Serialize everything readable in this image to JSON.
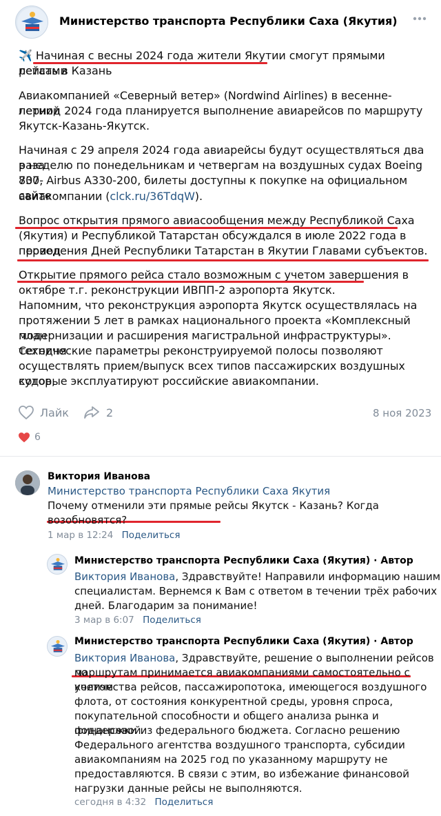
{
  "header": {
    "community_name": "Министерство транспорта Республики Саха (Якутия)",
    "more_icon": "more-horizontal-icon"
  },
  "post": {
    "emoji": "✈️",
    "title_line1": "Начиная с весны 2024 года жители Якутии смогут прямыми рейсами",
    "title_line2": "летать в Казань",
    "p2_line1": "Авиакомпанией «Северный ветер» (Nordwind Airlines) в весенне-летний",
    "p2_line2": "период 2024 года планируется выполнение авиарейсов по маршруту",
    "p2_line3": "Якутск-Казань-Якутск.",
    "p3_line1": "Начиная с 29 апреля 2024 года авиарейсы будут осуществляться два раза",
    "p3_line2": "в неделю по понедельникам и четвергам на воздушных судах Boeing 737-",
    "p3_line3": "800, Airbus A330-200, билеты доступны к покупке на официальном сайте",
    "p3_line4_pre": "авиакомпании (",
    "p3_link": "clck.ru/36TdqW",
    "p3_line4_post": ").",
    "p4_line1": "Вопрос открытия прямого авиасообщения между Республикой Саха",
    "p4_line2": "(Якутия) и Республикой Татарстан обсуждался в июле 2022 года в период",
    "p4_line3": "проведения Дней Республики Татарстан в Якутии Главами субъектов.",
    "p5_line1": "Открытие прямого рейса стало возможным с учетом завершения в",
    "p5_line2": "октябре т.г. реконструкции ИВПП-2 аэропорта Якутск.",
    "p5_line3": "Напомним, что реконструкция аэропорта Якутск осуществлялась на",
    "p5_line4": "протяжении 5 лет в рамках национального проекта «Комплексный план",
    "p5_line5": "модернизации и расширения магистральной инфраструктуры». Сегодня",
    "p5_line6": "технические параметры реконструируемой полосы позволяют",
    "p5_line7": "осуществлять прием/выпуск всех типов пассажирских воздушных судов,",
    "p5_line8": "которые эксплуатируют российские авиакомпании."
  },
  "actions": {
    "like_label": "Лайк",
    "share_count": "2",
    "date": "8 ноя 2023",
    "reactions_count": "6"
  },
  "comments": [
    {
      "author": "Виктория Иванова",
      "reply_to": "Министерство транспорта Республики Саха Якутия",
      "text_line1": "Почему отменили эти прямые рейсы Якутск - Казань? Когда",
      "text_line2": "возобновятся?",
      "time": "1 мар в 12:24",
      "share": "Поделиться"
    },
    {
      "author": "Министерство транспорта Республики Саха (Якутия) · Автор",
      "reply_to": "Виктория Иванова",
      "text_line1_post": ", Здравствуйте! Направили информацию нашим",
      "text_line2": "специалистам. Вернемся к Вам с ответом в течении трёх рабочих",
      "text_line3": "дней. Благодарим за понимание!",
      "time": "3 мар в 6:07",
      "share": "Поделиться"
    },
    {
      "author": "Министерство транспорта Республики Саха (Якутия) · Автор",
      "reply_to": "Виктория Иванова",
      "text_line1_post": ", Здравствуйте, решение о выполнении рейсов по",
      "text_line2": "маршрутам принимается авиакомпаниями самостоятельно с учетом",
      "text_line3": "количества рейсов, пассажиропотока, имеющегося воздушного",
      "text_line4": "флота, от состояния конкурентной среды, уровня спроса,",
      "text_line5": "покупательной способности и общего анализа рынка и финансовой",
      "text_line6": "поддержки из федерального бюджета. Согласно решению",
      "text_line7": "Федерального агентства воздушного транспорта, субсидии",
      "text_line8": "авиакомпаниям на 2025 год по указанному маршруту не",
      "text_line9": "предоставляются. В связи с этим, во избежание финансовой",
      "text_line10": "нагрузки данные рейсы не выполняются.",
      "time": "сегодня в 4:32",
      "share": "Поделиться"
    }
  ],
  "colors": {
    "link": "#2a5885",
    "highlight": "#e0252d",
    "muted": "#818c99",
    "heart": "#e64646"
  }
}
